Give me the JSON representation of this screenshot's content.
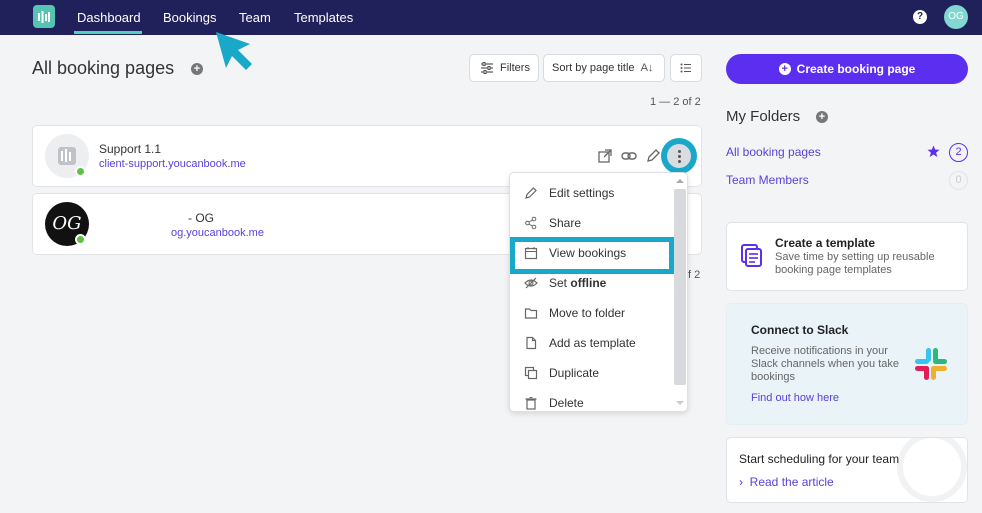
{
  "nav": {
    "items": [
      "Dashboard",
      "Bookings",
      "Team",
      "Templates"
    ],
    "help_label": "?",
    "avatar_initials": "OG"
  },
  "header": {
    "title": "All booking pages",
    "filters_label": "Filters",
    "sort_label": "Sort by page title",
    "pagination": "1 — 2 of 2"
  },
  "cards": [
    {
      "title": "Support 1.1",
      "link": "client-support.youcanbook.me"
    },
    {
      "title": "- OG",
      "link": "og.youcanbook.me",
      "avatar_text": "OG"
    }
  ],
  "menu": {
    "items": [
      {
        "icon": "pencil-icon",
        "label": "Edit settings"
      },
      {
        "icon": "share-icon",
        "label": "Share"
      },
      {
        "icon": "calendar-icon",
        "label": "View bookings"
      },
      {
        "icon": "eye-off-icon",
        "label_prefix": "Set ",
        "label_bold": "offline"
      },
      {
        "icon": "folder-icon",
        "label": "Move to folder"
      },
      {
        "icon": "document-icon",
        "label": "Add as template"
      },
      {
        "icon": "duplicate-icon",
        "label": "Duplicate"
      },
      {
        "icon": "trash-icon",
        "label": "Delete"
      }
    ],
    "hidden_pagination_fragment": "f 2"
  },
  "sidebar": {
    "create_button": "Create booking page",
    "folders_title": "My Folders",
    "folders": [
      {
        "label": "All booking pages",
        "count": "2"
      },
      {
        "label": "Team Members",
        "count": "0"
      }
    ],
    "template_panel": {
      "title": "Create a template",
      "text": "Save time by setting up reusable booking page templates"
    },
    "slack_panel": {
      "title": "Connect to Slack",
      "text": "Receive notifications in your Slack channels when you take bookings",
      "link": "Find out how here"
    },
    "team_panel": {
      "title": "Start scheduling for your team",
      "link": "Read the article"
    }
  },
  "colors": {
    "nav_bg": "#20215a",
    "accent_purple": "#5b2ef0",
    "link_purple": "#5b3fd9",
    "highlight_cyan": "#1aa8c9",
    "status_green": "#5cc33f"
  }
}
